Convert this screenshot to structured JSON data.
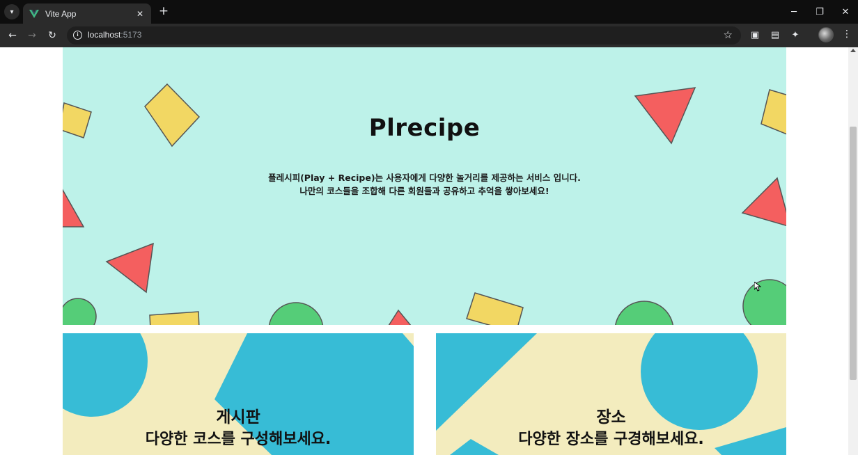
{
  "browser": {
    "tab_title": "Vite App",
    "url_host": "localhost",
    "url_port": ":5173"
  },
  "hero": {
    "title": "Plrecipe",
    "desc_line1": "플레시피(Play + Recipe)는 사용자에게 다양한 놀거리를 제공하는 서비스 입니다.",
    "desc_line2": "나만의 코스들을 조합해 다른 회원들과 공유하고 추억을 쌓아보세요!"
  },
  "cards": [
    {
      "title": "게시판",
      "subtitle": "다양한 코스를 구성해보세요."
    },
    {
      "title": "장소",
      "subtitle": "다양한 장소를 구경해보세요."
    }
  ],
  "colors": {
    "hero_bg": "#bdf2e9",
    "shape_yellow": "#f2d763",
    "shape_red": "#f45f5f",
    "shape_green": "#55cd78",
    "card_bg": "#f3ecbe",
    "card_shape_blue": "#37bcd6"
  }
}
